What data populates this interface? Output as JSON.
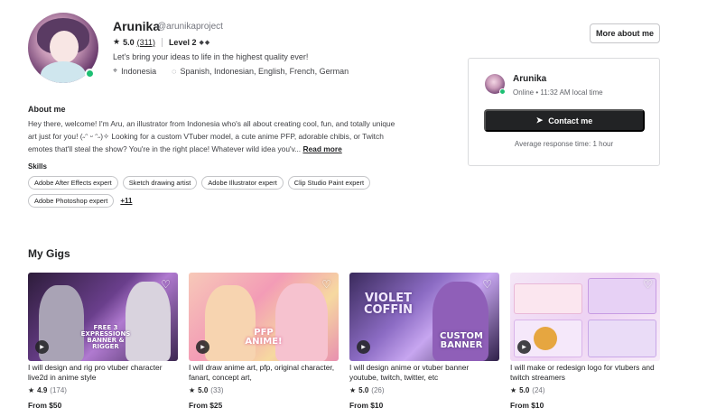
{
  "profile": {
    "name": "Arunika",
    "handle": "@arunikaproject",
    "rating": "5.0",
    "review_count": "(311)",
    "level": "Level 2",
    "level_diamonds": "◆◆",
    "tagline": "Let's bring your ideas to life in the highest quality ever!",
    "location": "Indonesia",
    "languages": "Spanish, Indonesian, English, French, German",
    "more_button": "More about me"
  },
  "contact_card": {
    "name": "Arunika",
    "status": "Online • 11:32 AM local time",
    "contact_button": "Contact me",
    "response_time": "Average response time: 1 hour"
  },
  "about": {
    "title": "About me",
    "text": "Hey there, welcome! I'm Aru, an illustrator from Indonesia who's all about creating cool, fun, and totally unique art just for you! (˶ᵔ ᵕ ᵔ˶)✧ Looking for a custom VTuber model, a cute anime PFP, adorable chibis, or Twitch emotes that'll steal the show? You're in the right place! Whatever wild idea you'v...",
    "read_more": "Read more"
  },
  "skills": {
    "title": "Skills",
    "items": [
      "Adobe After Effects expert",
      "Sketch drawing artist",
      "Adobe Illustrator expert",
      "Clip Studio Paint expert",
      "Adobe Photoshop expert"
    ],
    "more": "+11"
  },
  "gigs": {
    "title": "My Gigs",
    "items": [
      {
        "title": "I will design and rig pro vtuber character live2d in anime style",
        "rating": "4.9",
        "count": "(174)",
        "price": "From $50",
        "thumb_text": "FREE 3 EXPRESSIONS BANNER & RIGGER"
      },
      {
        "title": "I will draw anime art, pfp, original character, fanart, concept art,",
        "rating": "5.0",
        "count": "(33)",
        "price": "From $25",
        "thumb_text": "PFP ANIME!"
      },
      {
        "title": "I will design anime or vtuber banner youtube, twitch, twitter, etc",
        "rating": "5.0",
        "count": "(26)",
        "price": "From $10",
        "thumb_text": "VIOLET COFFIN",
        "thumb_text2": "CUSTOM BANNER"
      },
      {
        "title": "I will make or redesign logo for vtubers and twitch streamers",
        "rating": "5.0",
        "count": "(24)",
        "price": "From $10",
        "thumb_text": ""
      }
    ]
  },
  "colors": {
    "online": "#1dbf73",
    "dark_button": "#222325",
    "text": "#404145"
  }
}
